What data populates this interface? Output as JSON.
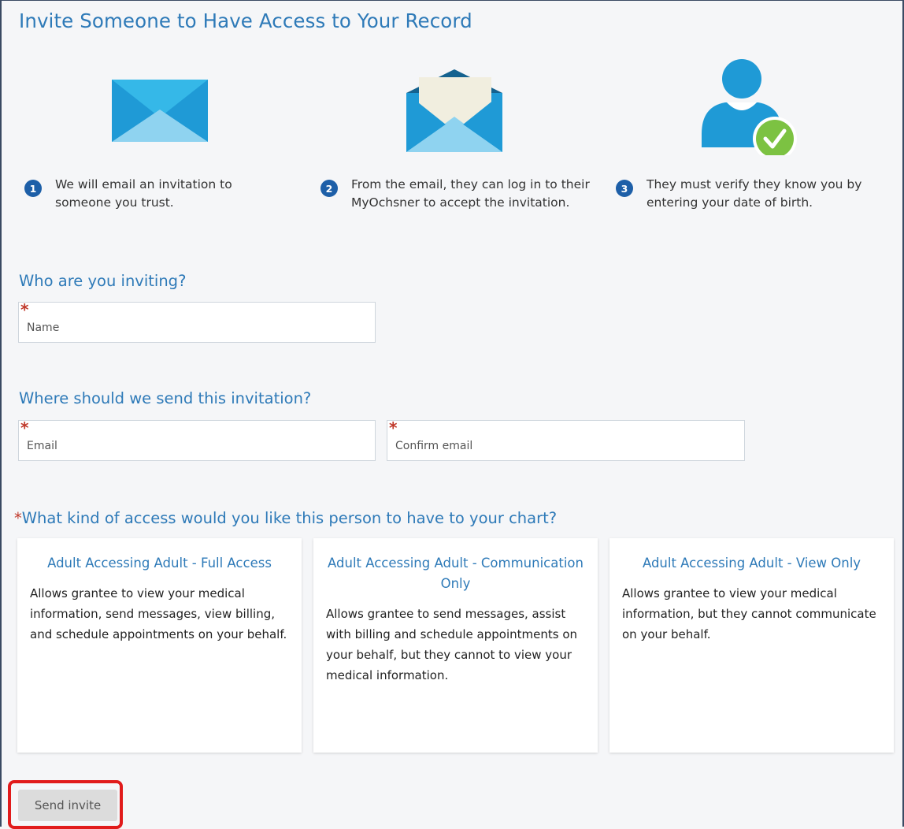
{
  "page": {
    "title": "Invite Someone to Have Access to Your Record"
  },
  "steps": [
    {
      "number": "1",
      "text": "We will email an invitation to someone you trust.",
      "icon": "envelope-closed-icon"
    },
    {
      "number": "2",
      "text": "From the email, they can log in to their MyOchsner to accept the invitation.",
      "icon": "envelope-open-icon"
    },
    {
      "number": "3",
      "text": "They must verify they know you by entering your date of birth.",
      "icon": "user-verified-icon"
    }
  ],
  "who_section": {
    "title": "Who are you inviting?",
    "name_placeholder": "Name",
    "name_value": ""
  },
  "where_section": {
    "title": "Where should we send this invitation?",
    "email_placeholder": "Email",
    "email_value": "",
    "confirm_placeholder": "Confirm email",
    "confirm_value": ""
  },
  "access_section": {
    "required_marker": "*",
    "title": "What kind of access would you like this person to have to your chart?",
    "options": [
      {
        "title": "Adult Accessing Adult - Full Access",
        "description": "Allows grantee to view your medical information, send messages, view billing, and schedule appointments on your behalf."
      },
      {
        "title": "Adult Accessing Adult - Communication Only",
        "description": "Allows grantee to send messages, assist with billing and schedule appointments on your behalf, but they cannot to view your medical information."
      },
      {
        "title": "Adult Accessing Adult - View Only",
        "description": "Allows grantee to view your medical information, but they cannot communicate on your behalf."
      }
    ]
  },
  "actions": {
    "send_label": "Send invite"
  },
  "colors": {
    "accent": "#2e7ab8",
    "step_badge": "#1d5fa8",
    "required": "#c0392b",
    "highlight": "#e11b1b",
    "check": "#7cc242"
  }
}
